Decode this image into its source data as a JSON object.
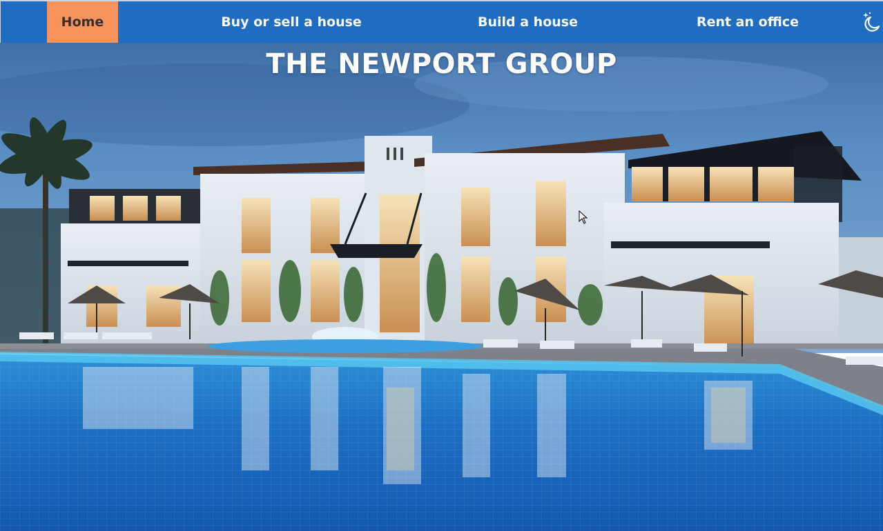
{
  "nav": {
    "items": [
      {
        "label": "Home",
        "active": true
      },
      {
        "label": "Buy or sell a house",
        "active": false
      },
      {
        "label": "Build a house",
        "active": false
      },
      {
        "label": "Rent an office",
        "active": false
      }
    ],
    "theme_toggle_icon": "moon-stars-icon"
  },
  "hero": {
    "title": "THE NEWPORT GROUP",
    "image": "luxury-villa-with-pool-photo"
  },
  "colors": {
    "nav_background": "#1e6dc2",
    "active_tab": "#f7945d",
    "nav_text": "#ffffff",
    "active_text": "#3a2e2a"
  }
}
